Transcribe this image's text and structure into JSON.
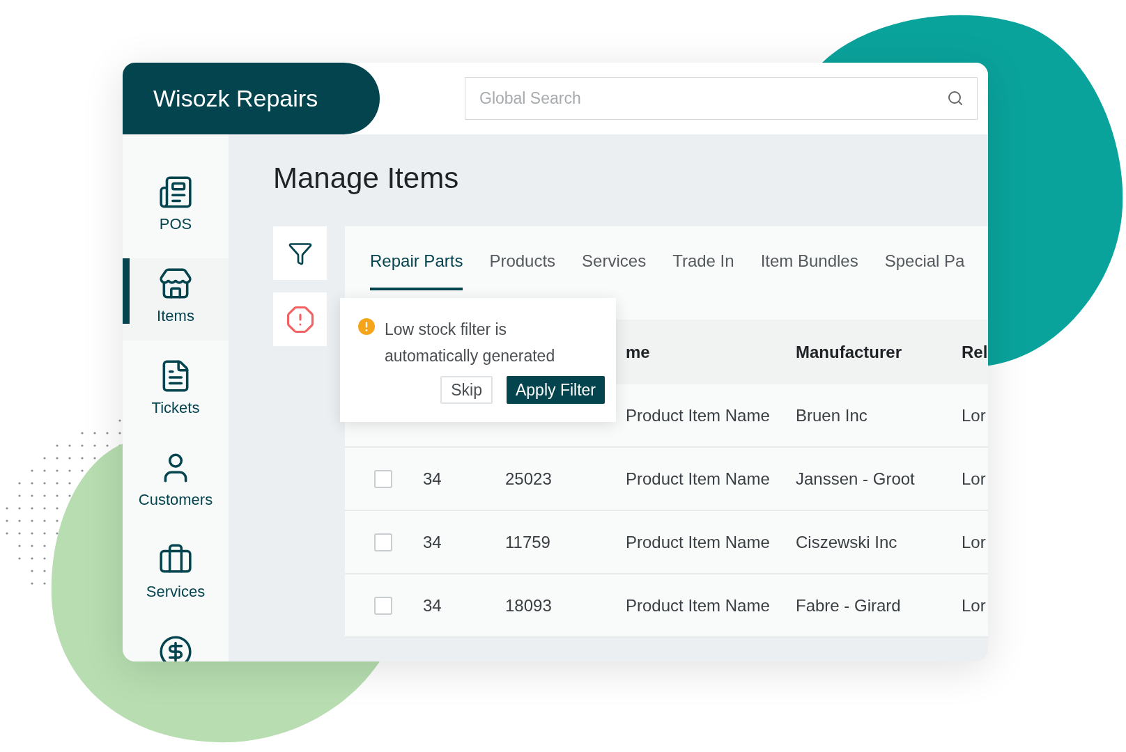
{
  "app": {
    "brand": "Wisozk Repairs"
  },
  "search": {
    "placeholder": "Global Search"
  },
  "sidebar": {
    "items": [
      {
        "kind": "pos",
        "label": "POS",
        "selected": false
      },
      {
        "kind": "items",
        "label": "Items",
        "selected": true
      },
      {
        "kind": "tickets",
        "label": "Tickets",
        "selected": false
      },
      {
        "kind": "customers",
        "label": "Customers",
        "selected": false
      },
      {
        "kind": "services",
        "label": "Services",
        "selected": false
      },
      {
        "kind": "billing",
        "selected": false
      }
    ]
  },
  "page": {
    "title": "Manage Items"
  },
  "tabs": [
    {
      "label": "Repair Parts",
      "selected": true
    },
    {
      "label": "Products",
      "selected": false
    },
    {
      "label": "Services",
      "selected": false
    },
    {
      "label": "Trade In",
      "selected": false
    },
    {
      "label": "Item Bundles",
      "selected": false
    },
    {
      "label": "Special Pa",
      "selected": false
    }
  ],
  "popover": {
    "message": "Low stock filter is automatically generated",
    "buttons": [
      {
        "label": "Skip",
        "kind": "secondary"
      },
      {
        "label": "Apply Filter",
        "kind": "primary"
      }
    ]
  },
  "table": {
    "columns": [
      "me",
      "Manufacturer",
      "Rel"
    ],
    "rows": [
      {
        "name": "Product Item Name",
        "manufacturer": "Bruen Inc",
        "column_6": "Lor"
      },
      {
        "checked": false,
        "qty": "34",
        "id": "25023",
        "name": "Product Item Name",
        "manufacturer": "Janssen - Groot",
        "column_6": "Lor"
      },
      {
        "checked": false,
        "qty": "34",
        "id": "11759",
        "name": "Product Item Name",
        "manufacturer": "Ciszewski Inc",
        "column_6": "Lor"
      },
      {
        "checked": false,
        "qty": "34",
        "id": "18093",
        "name": "Product Item Name",
        "manufacturer": "Fabre - Girard",
        "column_6": "Lor"
      }
    ]
  }
}
